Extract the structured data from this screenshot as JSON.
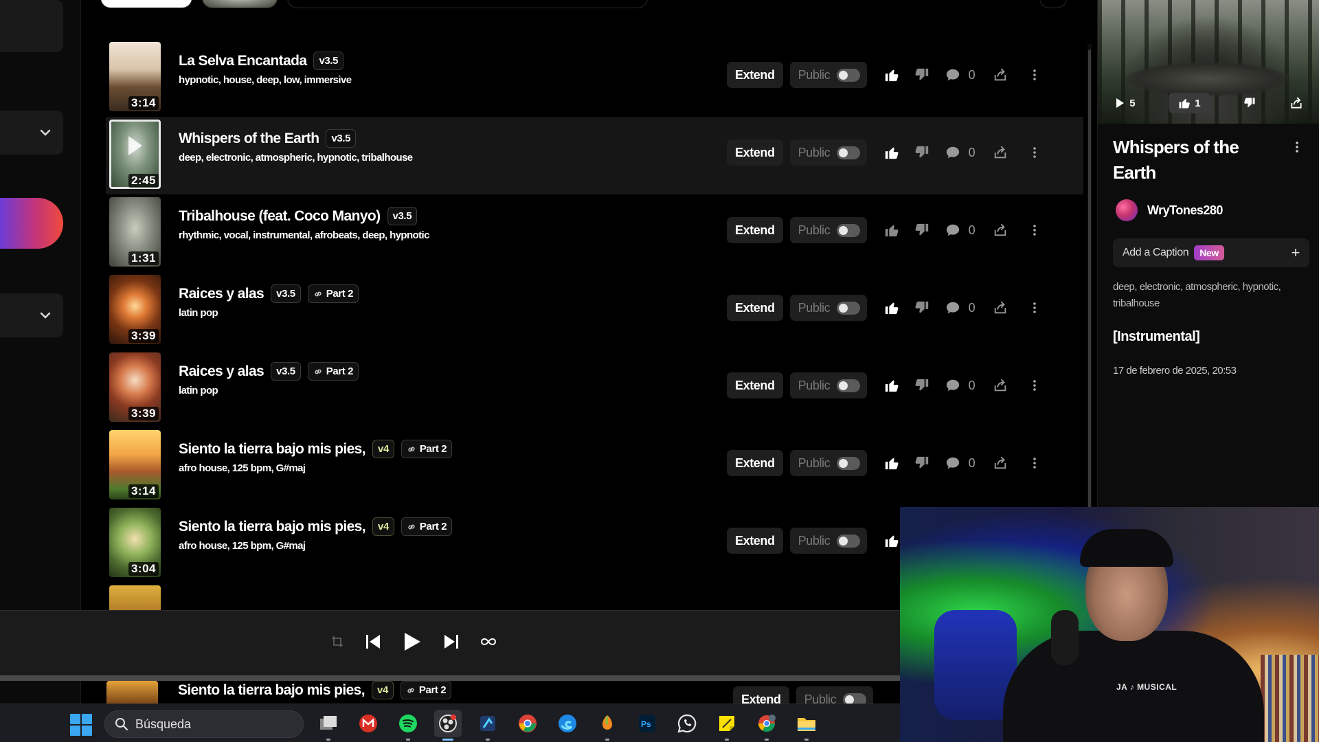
{
  "search": {
    "placeholder": "Búsqueda"
  },
  "songs": [
    {
      "title": "La Selva Encantada",
      "version": "v3.5",
      "part": "",
      "tags": "hypnotic, house, deep, low, immersive",
      "duration": "3:14",
      "comments": "0",
      "liked": true
    },
    {
      "title": "Whispers of the Earth",
      "version": "v3.5",
      "part": "",
      "tags": "deep, electronic, atmospheric, hypnotic, tribalhouse",
      "duration": "2:45",
      "comments": "0",
      "liked": true
    },
    {
      "title": "Tribalhouse (feat. Coco Manyo)",
      "version": "v3.5",
      "part": "",
      "tags": "rhythmic, vocal, instrumental, afrobeats, deep, hypnotic",
      "duration": "1:31",
      "comments": "0",
      "liked": false
    },
    {
      "title": "Raices y alas",
      "version": "v3.5",
      "part": "Part 2",
      "tags": "latin pop",
      "duration": "3:39",
      "comments": "0",
      "liked": true
    },
    {
      "title": "Raices y alas",
      "version": "v3.5",
      "part": "Part 2",
      "tags": "latin pop",
      "duration": "3:39",
      "comments": "0",
      "liked": true
    },
    {
      "title": "Siento la tierra bajo mis pies,",
      "version": "v4",
      "part": "Part 2",
      "tags": "afro house, 125 bpm, G#maj",
      "duration": "3:14",
      "comments": "0",
      "liked": true
    },
    {
      "title": "Siento la tierra bajo mis pies,",
      "version": "v4",
      "part": "Part 2",
      "tags": "afro house, 125 bpm, G#maj",
      "duration": "3:04",
      "comments": "",
      "liked": true
    }
  ],
  "peek_song": {
    "title": "Siento la tierra bajo mis pies,",
    "version": "v4",
    "part": "Part 2"
  },
  "labels": {
    "extend": "Extend",
    "public": "Public"
  },
  "detail": {
    "plays": "5",
    "likes": "1",
    "title": "Whispers of the Earth",
    "user": "WryTones280",
    "caption_label": "Add a Caption",
    "caption_badge": "New",
    "caption_plus": "+",
    "tags": "deep, electronic, atmospheric, hypnotic, tribalhouse",
    "lyrics": "[Instrumental]",
    "date": "17 de febrero de 2025, 20:53"
  },
  "webcam": {
    "shirt_text": "JA ♪ MUSICAL"
  },
  "taskbar_apps": [
    "task-view-icon",
    "gmail-icon",
    "spotify-icon",
    "obs-icon",
    "app-icon",
    "chrome-icon",
    "edge-icon",
    "fl-studio-icon",
    "photoshop-icon",
    "whatsapp-icon",
    "sticky-notes-icon",
    "chrome-profile-icon",
    "file-explorer-icon"
  ]
}
